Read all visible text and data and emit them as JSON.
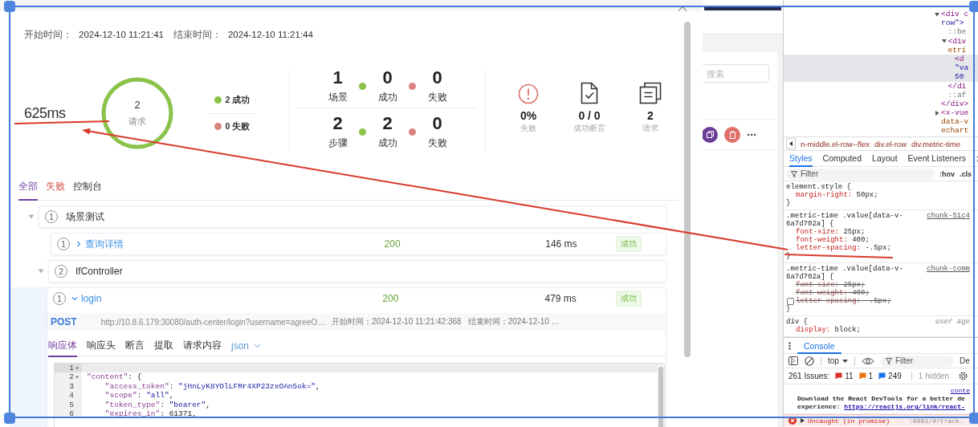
{
  "dialog": {
    "times": [
      {
        "label": "开始时间：",
        "value": "2024-12-10 11:21:41"
      },
      {
        "label": "结束时间：",
        "value": "2024-12-10 11:21:44"
      }
    ],
    "duration": "625ms",
    "ring": {
      "value": "2",
      "label": "请求",
      "level": 1
    },
    "legend": [
      {
        "text": "2 成功",
        "color": "#8bc34a"
      },
      {
        "text": "0 失败",
        "color": "#d98580"
      }
    ],
    "counts": [
      {
        "items": [
          {
            "kind": "total",
            "value": "1",
            "label": "场景"
          },
          {
            "kind": "success",
            "value": "0",
            "label": "成功"
          },
          {
            "kind": "fail",
            "value": "0",
            "label": "失败"
          }
        ]
      },
      {
        "items": [
          {
            "kind": "total",
            "value": "2",
            "label": "步骤"
          },
          {
            "kind": "success",
            "value": "2",
            "label": "成功"
          },
          {
            "kind": "fail",
            "value": "0",
            "label": "失败"
          }
        ]
      }
    ],
    "metrics": [
      {
        "kind": "fail-rate",
        "value": "0%",
        "label": "失败"
      },
      {
        "kind": "assertion",
        "value": "0 / 0",
        "label": "成功断言"
      },
      {
        "kind": "requests",
        "value": "2",
        "label": "请求"
      }
    ],
    "tabs": [
      {
        "label": "全部",
        "kind": "all",
        "selected": true
      },
      {
        "label": "失败",
        "kind": "fail",
        "selected": false
      },
      {
        "label": "控制台",
        "kind": "console",
        "selected": false
      }
    ],
    "tree": [
      {
        "index": "1",
        "title": "场景测试",
        "kind": "group",
        "expanded": true,
        "children": [
          {
            "index": "1",
            "title": "查询详情",
            "kind": "request",
            "expanded": false,
            "status": "200",
            "time": "146 ms",
            "result": "成功",
            "passed": true
          },
          {
            "index": "2",
            "title": "IfController",
            "kind": "group",
            "expanded": true,
            "children": [
              {
                "index": "1",
                "title": "login",
                "kind": "request",
                "expanded": true,
                "status": "200",
                "time": "479 ms",
                "result": "成功",
                "passed": true,
                "detail": {
                  "method": "POST",
                  "url": "http://10.8.6.179:30080/auth-center/login?username=agreeO…",
                  "start": "开始时间：2024-12-10 11:21:42:368",
                  "end": "结束时间：2024-12-10 …",
                  "tabs": [
                    {
                      "label": "响应体",
                      "selected": true
                    },
                    {
                      "label": "响应头",
                      "selected": false
                    },
                    {
                      "label": "断言",
                      "selected": false
                    },
                    {
                      "label": "提取",
                      "selected": false
                    },
                    {
                      "label": "请求内容",
                      "selected": false
                    }
                  ],
                  "format": "json",
                  "code": [
                    {
                      "number": "1",
                      "foldable": true,
                      "active": true
                    },
                    {
                      "number": "2",
                      "text": "\"content\": {",
                      "foldable": true,
                      "active": false
                    },
                    {
                      "number": "3",
                      "text": "    \"access_token\": \"jHnLyK8YOlLFMr4XP23zxOAn5ok=\",",
                      "foldable": false,
                      "active": false
                    },
                    {
                      "number": "4",
                      "text": "    \"scope\": \"all\",",
                      "foldable": false,
                      "active": false
                    },
                    {
                      "number": "5",
                      "text": "    \"token_type\": \"bearer\",",
                      "foldable": false,
                      "active": false
                    },
                    {
                      "number": "6",
                      "text": "    \"expires_in\": 61371,",
                      "foldable": false,
                      "active": false
                    }
                  ]
                }
              }
            ]
          }
        ]
      }
    ]
  },
  "backdrop": {
    "search": {
      "placeholder": "搜索"
    }
  },
  "devtools": {
    "elements": [
      {
        "text": "<div c",
        "kind": "tag",
        "expanded": true,
        "selected": false,
        "wrap": [
          {
            "text": "row\">",
            "kind": "value"
          }
        ],
        "children": [
          {
            "text": "::be",
            "kind": "pseudo",
            "selected": false
          },
          {
            "text": "<div",
            "kind": "tag",
            "expanded": true,
            "selected": false,
            "wrap": [
              {
                "text": "etri",
                "kind": "attr"
              }
            ],
            "children": [
              {
                "text": "<d",
                "kind": "tag",
                "selected": true,
                "wrap": [
                  {
                    "text": "\"va",
                    "kind": "value"
                  },
                  {
                    "text": "50",
                    "kind": "value"
                  }
                ]
              }
            ]
          },
          {
            "text": "</di",
            "kind": "tag",
            "selected": false
          },
          {
            "text": "::af",
            "kind": "pseudo",
            "selected": false
          }
        ]
      },
      {
        "text": "</div>",
        "kind": "tag",
        "selected": false
      },
      {
        "text": "<x-vue",
        "kind": "tag",
        "expanded": false,
        "selected": false,
        "wrap": [
          {
            "text": "data-v",
            "kind": "attr"
          },
          {
            "text": "echart",
            "kind": "attr"
          }
        ]
      }
    ],
    "breadcrumbs": [
      "n-middle.el-row--flex",
      "div.el-row",
      "div.metric-time"
    ],
    "panel_tabs": [
      {
        "label": "Styles",
        "selected": true
      },
      {
        "label": "Computed",
        "selected": false
      },
      {
        "label": "Layout",
        "selected": false
      },
      {
        "label": "Event Listeners",
        "selected": false
      }
    ],
    "filter": {
      "placeholder": "Filter"
    },
    "hov": ":hov",
    "cls": ".cls",
    "rules": [
      {
        "selector": [
          "element.style {"
        ],
        "props": [
          {
            "name": "margin-right:",
            "value": "50px;",
            "overridden": false,
            "disabled": false
          }
        ],
        "close": "}"
      },
      {
        "selector": [
          ".metric-time .value[data-v-",
          "6a7d702a] {"
        ],
        "source": "chunk-51c4",
        "kind": "file",
        "props": [
          {
            "name": "font-size:",
            "value": "25px;",
            "overridden": false,
            "disabled": false
          },
          {
            "name": "font-weight:",
            "value": "400;",
            "overridden": false,
            "disabled": false
          },
          {
            "name": "letter-spacing:",
            "value": "-.5px;",
            "overridden": false,
            "disabled": false
          }
        ],
        "close": "}"
      },
      {
        "selector": [
          ".metric-time .value[data-v-",
          "6a7d702a] {"
        ],
        "source": "chunk-comm",
        "kind": "file",
        "props": [
          {
            "name": "font-size:",
            "value": "25px;",
            "overridden": true,
            "disabled": false
          },
          {
            "name": "font-weight:",
            "value": "400;",
            "overridden": true,
            "disabled": false
          },
          {
            "name": "letter-spacing:",
            "value": "-.5px;",
            "overridden": true,
            "disabled": true
          }
        ],
        "close": "}"
      },
      {
        "selector": [
          "div {"
        ],
        "source": "user age",
        "kind": "agent",
        "props": [
          {
            "name": "display:",
            "value": "block;",
            "overridden": false,
            "disabled": false
          }
        ]
      }
    ],
    "console": {
      "tab": "Console",
      "context": "top",
      "filter": {
        "placeholder": "Filter"
      },
      "levels": "De",
      "issues": {
        "label": "261 Issues:",
        "counts": [
          {
            "kind": "error",
            "value": "11"
          },
          {
            "kind": "warning",
            "value": "1"
          },
          {
            "kind": "info",
            "value": "249"
          }
        ],
        "hidden": "1 hidden"
      },
      "messages": [
        {
          "kind": "log",
          "source": "conte",
          "text": "Download the React DevTools for a better de",
          "text_2": "experience: ",
          "link": "https://reactjs.org/link/react-"
        },
        {
          "kind": "error",
          "text": "Uncaught (in promise)",
          "source": ":8081/#/track."
        }
      ]
    }
  }
}
